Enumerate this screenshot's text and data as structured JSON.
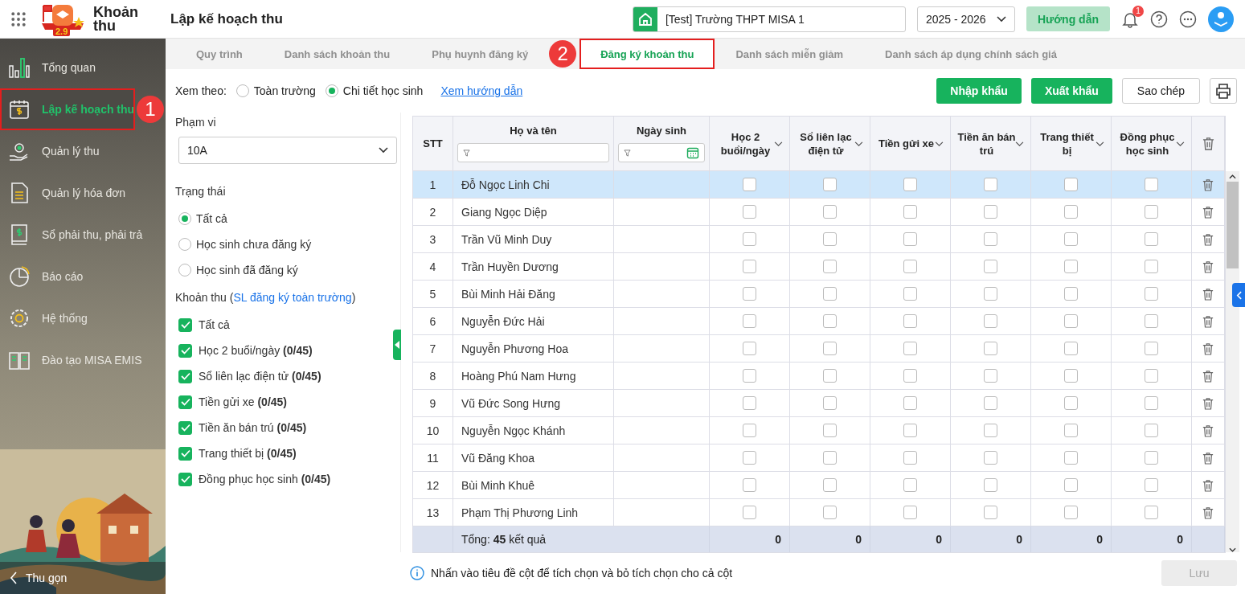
{
  "app": {
    "name": "Khoản thu",
    "logo_badge": "2.9",
    "page_title": "Lập kế hoạch thu"
  },
  "header": {
    "school": "[Test] Trường THPT MISA 1",
    "year": "2025 - 2026",
    "guide_button": "Hướng dẫn",
    "notification_count": "1"
  },
  "sidebar": {
    "items": [
      {
        "label": "Tổng quan",
        "selected": false
      },
      {
        "label": "Lập kế hoạch thu",
        "selected": true,
        "callout": "1"
      },
      {
        "label": "Quản lý thu",
        "selected": false
      },
      {
        "label": "Quản lý hóa đơn",
        "selected": false
      },
      {
        "label": "Sổ phải thu, phải trả",
        "selected": false
      },
      {
        "label": "Báo cáo",
        "selected": false
      },
      {
        "label": "Hệ thống",
        "selected": false
      },
      {
        "label": "Đào tạo MISA EMIS",
        "selected": false
      }
    ],
    "collapse": "Thu gọn"
  },
  "tabs": [
    {
      "label": "Quy trình",
      "selected": false
    },
    {
      "label": "Danh sách khoản thu",
      "selected": false
    },
    {
      "label": "Phụ huynh đăng ký",
      "selected": false
    },
    {
      "label": "Đăng ký khoản thu",
      "selected": true,
      "callout": "2"
    },
    {
      "label": "Danh sách miễn giảm",
      "selected": false
    },
    {
      "label": "Danh sách áp dụng chính sách giá",
      "selected": false
    }
  ],
  "view": {
    "label": "Xem theo:",
    "options": [
      {
        "label": "Toàn trường",
        "selected": false
      },
      {
        "label": "Chi tiết học sinh",
        "selected": true
      }
    ],
    "guide_link": "Xem hướng dẫn"
  },
  "actions": [
    {
      "label": "Nhập khẩu",
      "kind": "primary"
    },
    {
      "label": "Xuất khẩu",
      "kind": "primary"
    },
    {
      "label": "Sao chép",
      "kind": "outline"
    }
  ],
  "filters": {
    "scope_label": "Phạm vi",
    "scope_value": "10A",
    "status_label": "Trạng thái",
    "status_options": [
      {
        "label": "Tất cả",
        "selected": true
      },
      {
        "label": "Học sinh chưa đăng ký",
        "selected": false
      },
      {
        "label": "Học sinh đã đăng ký",
        "selected": false
      }
    ],
    "fees_title": "Khoản thu (",
    "fees_link": "SL đăng ký toàn trường",
    "fees_title_end": ")",
    "fees": [
      {
        "label": "Tất cả",
        "checked": true
      },
      {
        "label": "Học 2 buổi/ngày **(0/45)**",
        "checked": true
      },
      {
        "label": "Sổ liên lạc điện tử **(0/45)**",
        "checked": true
      },
      {
        "label": "Tiền gửi xe **(0/45)**",
        "checked": true
      },
      {
        "label": "Tiền ăn bán trú **(0/45)**",
        "checked": true
      },
      {
        "label": "Trang thiết bị **(0/45)**",
        "checked": true
      },
      {
        "label": "Đồng phục học sinh **(0/45)**",
        "checked": true
      }
    ]
  },
  "table": {
    "columns": [
      {
        "label": "STT",
        "kind": "index"
      },
      {
        "label": "Họ và tên",
        "kind": "name"
      },
      {
        "label": "Ngày sinh",
        "kind": "date"
      },
      {
        "label": "Học 2 buổi/ngày",
        "kind": "fee"
      },
      {
        "label": "Sổ liên lạc điện tử",
        "kind": "fee"
      },
      {
        "label": "Tiền gửi xe",
        "kind": "fee"
      },
      {
        "label": "Tiền ăn bán trú",
        "kind": "fee"
      },
      {
        "label": "Trang thiết bị",
        "kind": "fee"
      },
      {
        "label": "Đồng phục học sinh",
        "kind": "fee"
      },
      {
        "kind": "delete"
      }
    ],
    "rows": [
      {
        "stt": "1",
        "name": "Đỗ Ngọc Linh Chi",
        "selected": true,
        "fees": [
          false,
          false,
          false,
          false,
          false,
          false
        ]
      },
      {
        "stt": "2",
        "name": "Giang Ngọc Diệp",
        "selected": false,
        "fees": [
          false,
          false,
          false,
          false,
          false,
          false
        ]
      },
      {
        "stt": "3",
        "name": "Trần Vũ Minh Duy",
        "selected": false,
        "fees": [
          false,
          false,
          false,
          false,
          false,
          false
        ]
      },
      {
        "stt": "4",
        "name": "Trần Huyền Dương",
        "selected": false,
        "fees": [
          false,
          false,
          false,
          false,
          false,
          false
        ]
      },
      {
        "stt": "5",
        "name": "Bùi Minh Hải Đăng",
        "selected": false,
        "fees": [
          false,
          false,
          false,
          false,
          false,
          false
        ]
      },
      {
        "stt": "6",
        "name": "Nguyễn Đức Hải",
        "selected": false,
        "fees": [
          false,
          false,
          false,
          false,
          false,
          false
        ]
      },
      {
        "stt": "7",
        "name": "Nguyễn Phương Hoa",
        "selected": false,
        "fees": [
          false,
          false,
          false,
          false,
          false,
          false
        ]
      },
      {
        "stt": "8",
        "name": "Hoàng Phú Nam Hưng",
        "selected": false,
        "fees": [
          false,
          false,
          false,
          false,
          false,
          false
        ]
      },
      {
        "stt": "9",
        "name": "Vũ Đức Song Hưng",
        "selected": false,
        "fees": [
          false,
          false,
          false,
          false,
          false,
          false
        ]
      },
      {
        "stt": "10",
        "name": "Nguyễn Ngọc Khánh",
        "selected": false,
        "fees": [
          false,
          false,
          false,
          false,
          false,
          false
        ]
      },
      {
        "stt": "11",
        "name": "Vũ Đăng Khoa",
        "selected": false,
        "fees": [
          false,
          false,
          false,
          false,
          false,
          false
        ]
      },
      {
        "stt": "12",
        "name": "Bùi Minh Khuê",
        "selected": false,
        "fees": [
          false,
          false,
          false,
          false,
          false,
          false
        ]
      },
      {
        "stt": "13",
        "name": "Phạm Thị Phương Linh",
        "selected": false,
        "fees": [
          false,
          false,
          false,
          false,
          false,
          false
        ]
      }
    ],
    "total": "Tổng: **45** kết quả",
    "totals": [
      "0",
      "0",
      "0",
      "0",
      "0",
      "0"
    ]
  },
  "hint": "Nhấn vào tiêu đề cột để tích chọn và bỏ tích chọn cho cả cột",
  "save": {
    "label": "Lưu",
    "disabled": true
  }
}
